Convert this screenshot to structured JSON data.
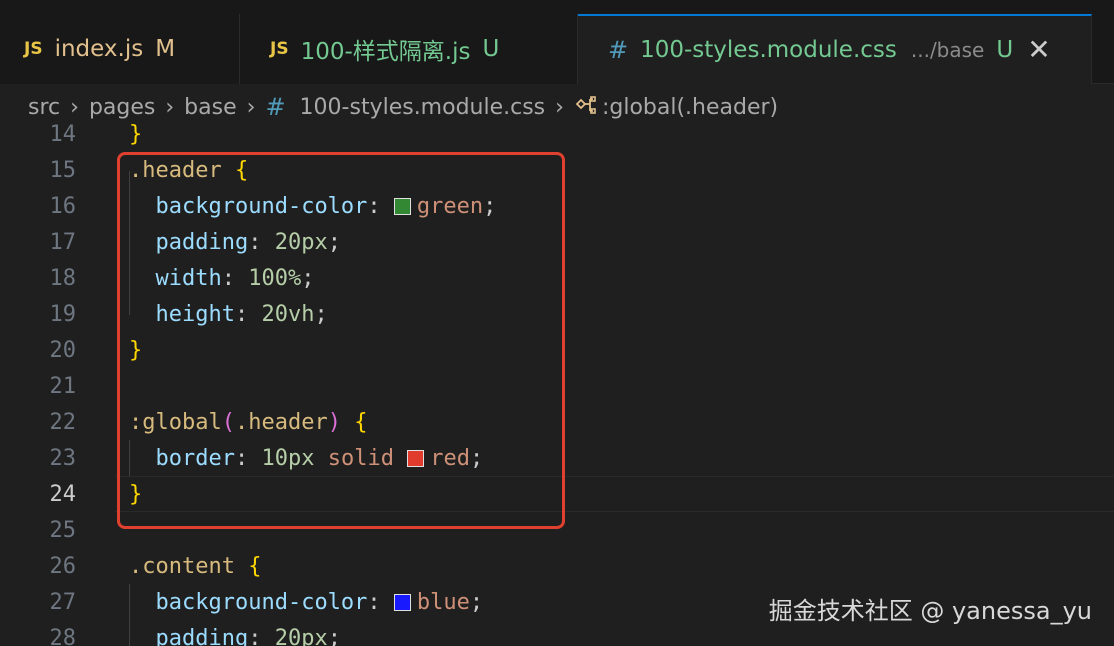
{
  "tabs": [
    {
      "type": "JS",
      "name": "index.js",
      "status": "M"
    },
    {
      "type": "JS",
      "name": "100-样式隔离.js",
      "status": "U"
    },
    {
      "type": "#",
      "name": "100-styles.module.css",
      "dir": ".../base",
      "status": "U",
      "close": "✕"
    }
  ],
  "breadcrumb": {
    "parts": [
      "src",
      "pages",
      "base"
    ],
    "file_icon": "#",
    "file": "100-styles.module.css",
    "symbol_icon": "symbol-class-icon",
    "symbol": ":global(.header)"
  },
  "lines": [
    {
      "n": "14"
    },
    {
      "n": "15"
    },
    {
      "n": "16"
    },
    {
      "n": "17"
    },
    {
      "n": "18"
    },
    {
      "n": "19"
    },
    {
      "n": "20"
    },
    {
      "n": "21"
    },
    {
      "n": "22"
    },
    {
      "n": "23"
    },
    {
      "n": "24"
    },
    {
      "n": "25"
    },
    {
      "n": "26"
    },
    {
      "n": "27"
    },
    {
      "n": "28"
    }
  ],
  "code": {
    "l14_close": "}",
    "l15_sel": ".header",
    "open": "{",
    "close": "}",
    "l16_prop": "background-color",
    "l16_val": "green",
    "l17_prop": "padding",
    "l17_val": "20px",
    "l18_prop": "width",
    "l18_val": "100%",
    "l19_prop": "height",
    "l19_val": "20vh",
    "l22_pseudo": ":global",
    "l22_paren_open": "(",
    "l22_sel": ".header",
    "l22_paren_close": ")",
    "l23_prop": "border",
    "l23_num": "10px",
    "l23_kw": "solid",
    "l23_val": "red",
    "l26_sel": ".content",
    "l27_prop": "background-color",
    "l27_val": "blue",
    "l28_prop": "padding",
    "l28_val": "20px",
    "colon": ":",
    "semi": ";"
  },
  "swatch_colors": {
    "green": "#338833",
    "red": "#e03b2c",
    "blue": "#1a1aff"
  },
  "highlight_color": "#e0402f",
  "active_line": "24",
  "watermark": "掘金技术社区 @ yanessa_yu"
}
